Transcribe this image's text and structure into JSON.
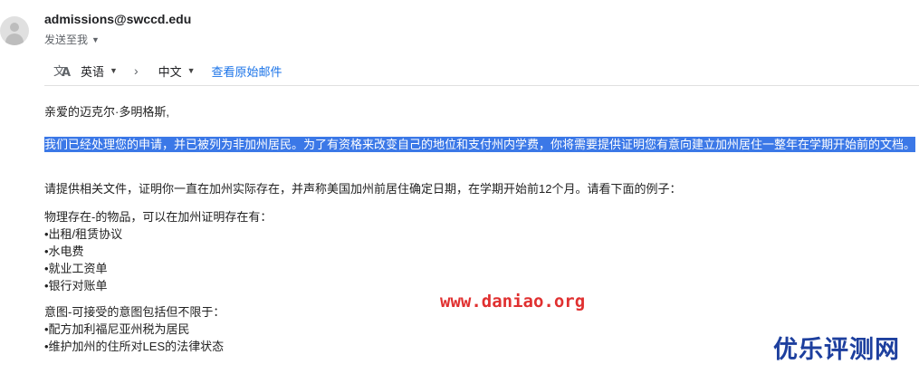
{
  "email": {
    "sender": "admissions@swccd.edu",
    "to_label": "发送至我"
  },
  "translate": {
    "source_lang": "英语",
    "target_lang": "中文",
    "view_original": "查看原始邮件"
  },
  "message": {
    "greeting": "亲爱的迈克尔·多明格斯,",
    "highlighted": "我们已经处理您的申请，并已被列为非加州居民。为了有资格来改变自己的地位和支付州内学费，你将需要提供证明您有意向建立加州居住一整年在学期开始前的文档。",
    "provide": "请提供相关文件，证明你一直在加州实际存在，并声称美国加州前居住确定日期，在学期开始前12个月。请看下面的例子：",
    "physical_title": "物理存在-的物品，可以在加州证明存在有：",
    "physical_items": [
      "•出租/租赁协议",
      "•水电费",
      "•就业工资单",
      "•银行对账单"
    ],
    "intent_title": "意图-可接受的意图包括但不限于：",
    "intent_items": [
      "•配方加利福尼亚州税为居民",
      "•维护加州的住所对LES的法律状态"
    ]
  },
  "watermarks": {
    "url": "www.daniao.org",
    "brand": "优乐评测网"
  }
}
